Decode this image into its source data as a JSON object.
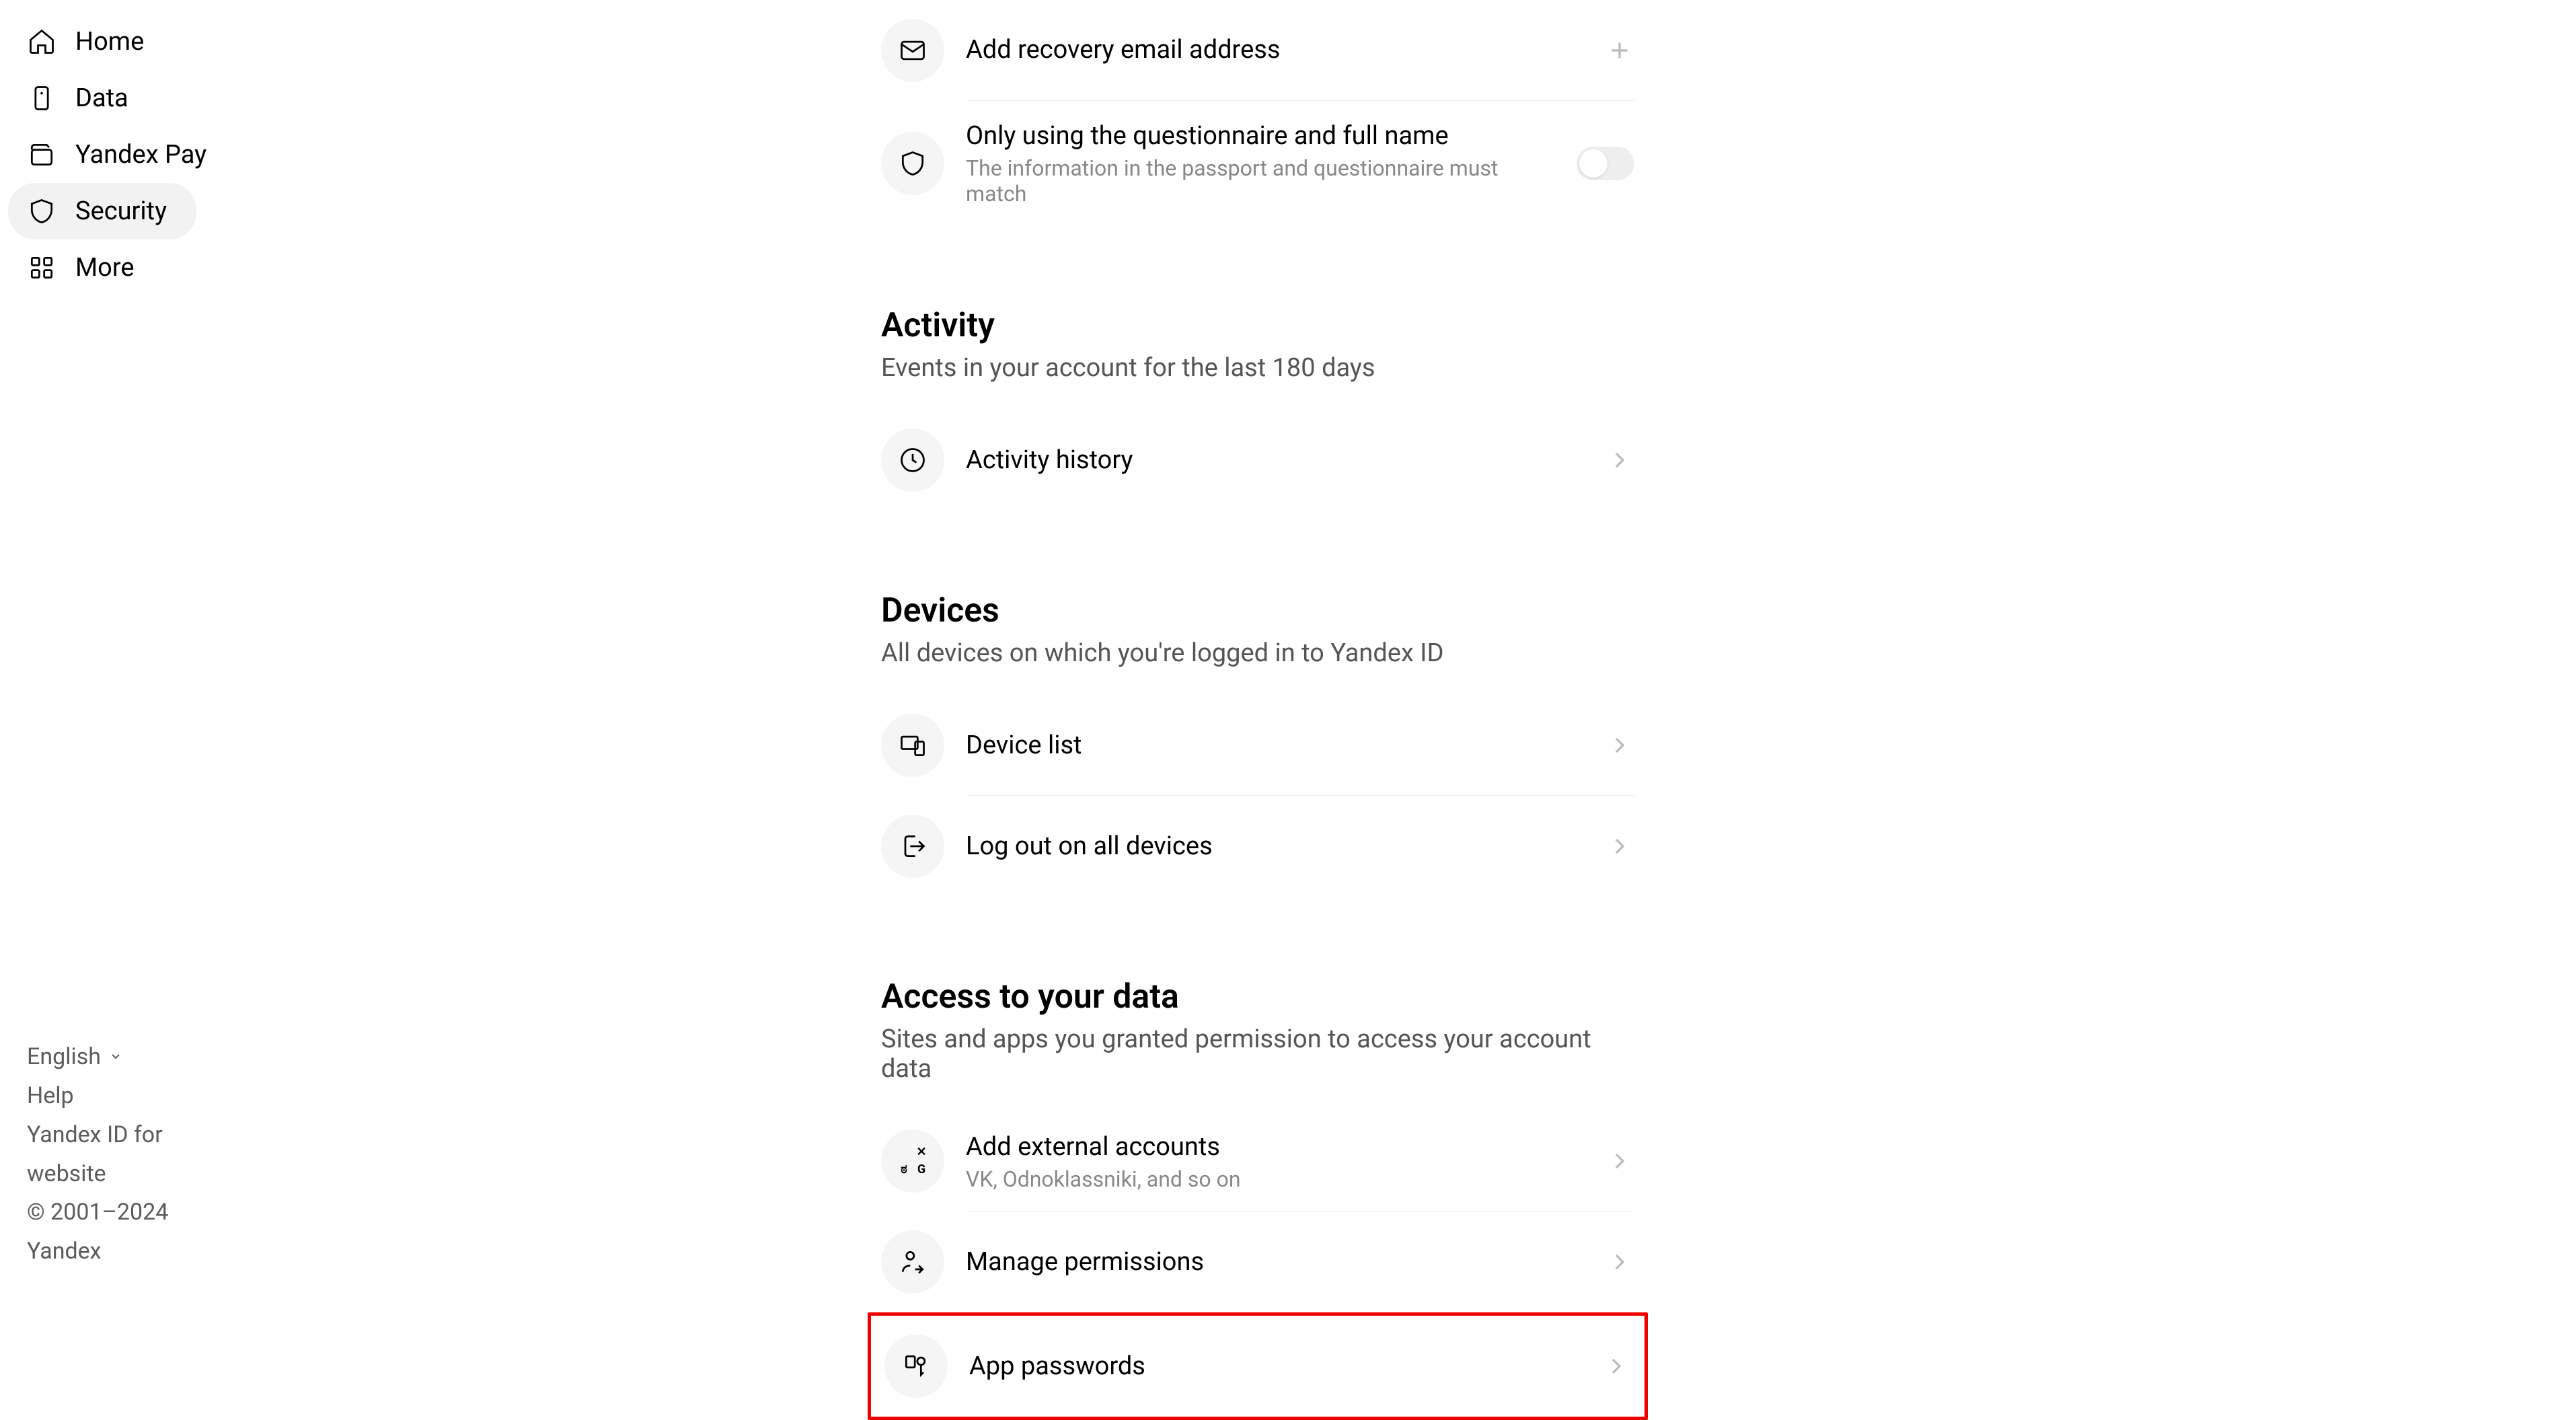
{
  "sidebar": {
    "items": [
      {
        "label": "Home"
      },
      {
        "label": "Data"
      },
      {
        "label": "Yandex Pay"
      },
      {
        "label": "Security"
      },
      {
        "label": "More"
      }
    ]
  },
  "footer": {
    "language": "English",
    "help": "Help",
    "for_website": "Yandex ID for website",
    "copyright": "© 2001–2024 Yandex"
  },
  "recovery": {
    "add_email": "Add recovery email address",
    "questionnaire_title": "Only using the questionnaire and full name",
    "questionnaire_sub": "The information in the passport and questionnaire must match"
  },
  "activity": {
    "heading": "Activity",
    "subheading": "Events in your account for the last 180 days",
    "history": "Activity history"
  },
  "devices": {
    "heading": "Devices",
    "subheading": "All devices on which you're logged in to Yandex ID",
    "list": "Device list",
    "logout_all": "Log out on all devices"
  },
  "access": {
    "heading": "Access to your data",
    "subheading": "Sites and apps you granted permission to access your account data",
    "external_title": "Add external accounts",
    "external_sub": "VK, Odnoklassniki, and so on",
    "manage": "Manage permissions",
    "app_passwords": "App passwords"
  }
}
